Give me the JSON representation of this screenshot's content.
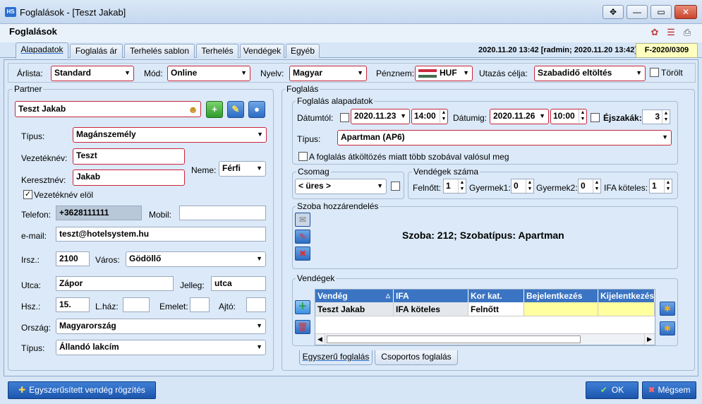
{
  "window": {
    "app_icon": "HS",
    "title": "Foglalások - [Teszt Jakab]",
    "btn_move": "✥",
    "btn_min": "—",
    "btn_max": "▭",
    "btn_close": "✕"
  },
  "page_title": "Foglalások",
  "tabs": [
    "Alapadatok",
    "Foglalás ár",
    "Terhelés sablon",
    "Terhelés",
    "Vendégek",
    "Egyéb"
  ],
  "info_text": "2020.11.20 13:42 [radmin; 2020.11.20 13:42]",
  "folio_id": "F-2020/0309",
  "top": {
    "arlista_label": "Árlista:",
    "arlista": "Standard",
    "mod_label": "Mód:",
    "mod": "Online",
    "nyelv_label": "Nyelv:",
    "nyelv": "Magyar",
    "penznem_label": "Pénznem:",
    "penznem": "HUF",
    "utazas_label": "Utazás célja:",
    "utazas": "Szabadidő eltöltés",
    "torolt_label": "Törölt"
  },
  "partner": {
    "group_label": "Partner",
    "name": "Teszt Jakab",
    "tipus_label": "Típus:",
    "tipus": "Magánszemély",
    "vezeteknev_label": "Vezetéknév:",
    "vezeteknev": "Teszt",
    "keresztnev_label": "Keresztnév:",
    "keresztnev": "Jakab",
    "neme_label": "Neme:",
    "neme": "Férfi",
    "vezeteknev_elol_label": "Vezetéknév elöl",
    "telefon_label": "Telefon:",
    "telefon": "+3628111111",
    "mobil_label": "Mobil:",
    "mobil": "",
    "email_label": "e-mail:",
    "email": "teszt@hotelsystem.hu",
    "irsz_label": "Irsz.:",
    "irsz": "2100",
    "varos_label": "Város:",
    "varos": "Gödöllő",
    "utca_label": "Utca:",
    "utca": "Zápor",
    "jelleg_label": "Jelleg:",
    "jelleg": "utca",
    "hsz_label": "Hsz.:",
    "hsz": "15.",
    "lhaz_label": "L.ház:",
    "emelet_label": "Emelet:",
    "ajto_label": "Ajtó:",
    "orszag_label": "Ország:",
    "orszag": "Magyarország",
    "tipus2_label": "Típus:",
    "tipus2": "Állandó lakcím"
  },
  "foglalas": {
    "group_label": "Foglalás",
    "alap_label": "Foglalás alapadatok",
    "datumtol_label": "Dátumtól:",
    "datumtol": "2020.11.23",
    "ido_tol": "14:00",
    "datumig_label": "Dátumig:",
    "datumig": "2020.11.26",
    "ido_ig": "10:00",
    "ejszakak_label": "Éjszakák:",
    "ejszakak": "3",
    "tipus_label": "Típus:",
    "tipus": "Apartman (AP6)",
    "atkoltozes_label": "A foglalás átköltözés miatt több szobával valósul meg",
    "csomag_label": "Csomag",
    "csomag": "< üres >",
    "vendegek_szama_label": "Vendégek száma",
    "felnott_label": "Felnőtt:",
    "felnott": "1",
    "gyermek1_label": "Gyermek1:",
    "gyermek1": "0",
    "gyermek2_label": "Gyermek2:",
    "gyermek2": "0",
    "ifa_label": "IFA köteles:",
    "ifa": "1",
    "szoba_label": "Szoba hozzárendelés",
    "szoba_text": "Szoba: 212; Szobatípus: Apartman",
    "vendegek_label": "Vendégek",
    "columns": [
      "Vendég",
      "IFA",
      "Kor kat.",
      "Bejelentkezés",
      "Kijelentkezés"
    ],
    "rows": [
      [
        "Teszt Jakab",
        "IFA köteles",
        "Felnőtt",
        "",
        ""
      ]
    ],
    "subtabs": [
      "Egyszerű foglalás",
      "Csoportos foglalás"
    ]
  },
  "footer": {
    "quick_label": "Egyszerűsített vendég rögzítés",
    "ok_label": "OK",
    "cancel_label": "Mégsem"
  },
  "colors": {
    "accent": "#2d6cc4",
    "required_border": "#c8263a",
    "highlight_cell": "#ffffa0"
  }
}
